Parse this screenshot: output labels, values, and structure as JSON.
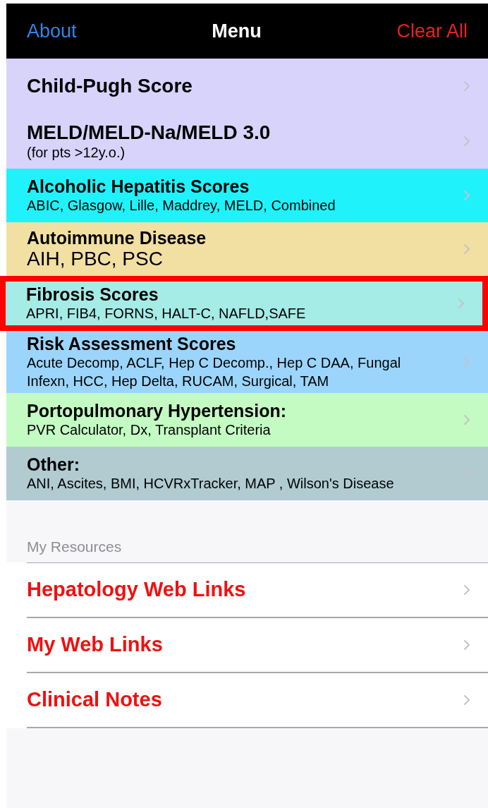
{
  "nav_bar": {
    "left_button": "About",
    "title": "Menu",
    "right_button": "Clear All"
  },
  "menu_items": [
    {
      "title": "Child-Pugh Score",
      "kind": "large",
      "color": "#d7d3fb",
      "highlighted": false
    },
    {
      "title": "MELD/MELD-Na/MELD 3.0",
      "subtitle": "(for pts >12y.o.)",
      "kind": "large",
      "color": "#d7d3fb",
      "highlighted": false
    },
    {
      "title": "Alcoholic Hepatitis Scores",
      "subtitle": "ABIC, Glasgow, Lille, Maddrey, MELD, Combined",
      "kind": "compact",
      "color": "#20f2fb",
      "highlighted": false
    },
    {
      "title": "Autoimmune Disease",
      "subtitle": "AIH, PBC, PSC",
      "kind": "emphasis",
      "color": "#f2dfa2",
      "highlighted": false
    },
    {
      "title": "Fibrosis Scores",
      "subtitle": "APRI, FIB4, FORNS, HALT-C, NAFLD,SAFE",
      "kind": "compact",
      "color": "#a5ebe6",
      "highlighted": true
    },
    {
      "title": "Risk Assessment Scores",
      "subtitle": "Acute Decomp, ACLF, Hep C Decomp., Hep C DAA, Fungal Infexn, HCC, Hep Delta, RUCAM, Surgical, TAM",
      "kind": "compact",
      "color": "#9bd5fb",
      "highlighted": false
    },
    {
      "title": "Portopulmonary Hypertension:",
      "subtitle": "PVR Calculator, Dx, Transplant Criteria",
      "kind": "compact",
      "color": "#c3fbc3",
      "highlighted": false
    },
    {
      "title": "Other:",
      "subtitle": "ANI, Ascites, BMI, HCVRxTracker, MAP , Wilson's Disease",
      "kind": "compact",
      "color": "#b1cbd1",
      "highlighted": false
    }
  ],
  "resources": {
    "header": "My Resources",
    "items": [
      "Hepatology Web Links",
      "My Web Links",
      "Clinical Notes"
    ]
  }
}
